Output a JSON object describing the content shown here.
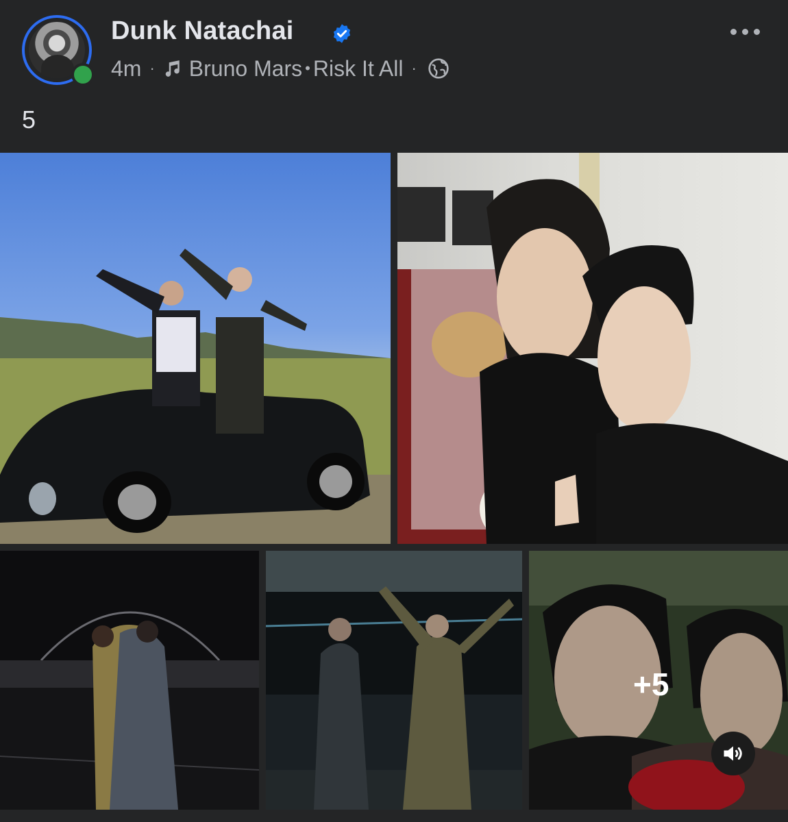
{
  "post": {
    "author_name": "Dunk Natachai",
    "time": "4m",
    "separator": "·",
    "music_artist": "Bruno Mars",
    "music_dot": "•",
    "music_title": "Risk It All",
    "caption": "5",
    "more_photos_label": "+5"
  },
  "icons": {
    "verified": "verified-badge-icon",
    "music": "music-note-icon",
    "privacy": "globe-icon",
    "more": "more-horizontal-icon",
    "sound": "speaker-icon"
  },
  "colors": {
    "background": "#242526",
    "verified": "#1877f2",
    "online": "#31a24c",
    "text_primary": "#e4e6eb",
    "text_secondary": "#b0b3b8"
  }
}
